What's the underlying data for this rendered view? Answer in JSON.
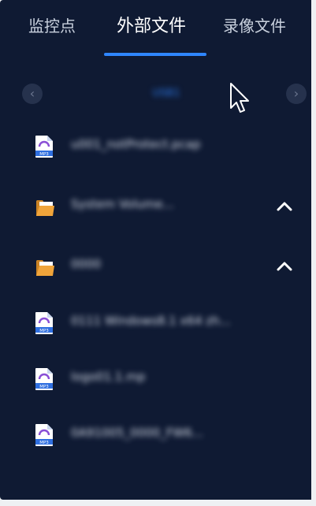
{
  "tabs": [
    {
      "label": "监控点",
      "active": false
    },
    {
      "label": "外部文件",
      "active": true
    },
    {
      "label": "录像文件",
      "active": false
    }
  ],
  "nav": {
    "prev_glyph": "‹",
    "next_glyph": "›",
    "current_folder": "USB1"
  },
  "files": [
    {
      "name": "u001_notProtect.pcap",
      "type": "mp3",
      "icon": "mp3-file-icon"
    },
    {
      "name": "System Volume...",
      "type": "folder",
      "icon": "folder-icon",
      "expand_icon": "chevron-up-icon"
    },
    {
      "name": "0000",
      "type": "folder",
      "icon": "folder-icon",
      "expand_icon": "chevron-up-icon"
    },
    {
      "name": "0111 Windows8.1 x64 zh...",
      "type": "mp3",
      "icon": "mp3-file-icon"
    },
    {
      "name": "logo01.1.mp",
      "type": "mp3",
      "icon": "mp3-file-icon"
    },
    {
      "name": "0A91005_0000_FW6...",
      "type": "mp3",
      "icon": "mp3-file-icon"
    }
  ],
  "file_badge": "MP3",
  "colors": {
    "background": "#0f1a33",
    "accent": "#2f86ff",
    "text": "#d7dde8",
    "folder": "#f0a43a",
    "mp3_badge": "#2f6fe0"
  }
}
